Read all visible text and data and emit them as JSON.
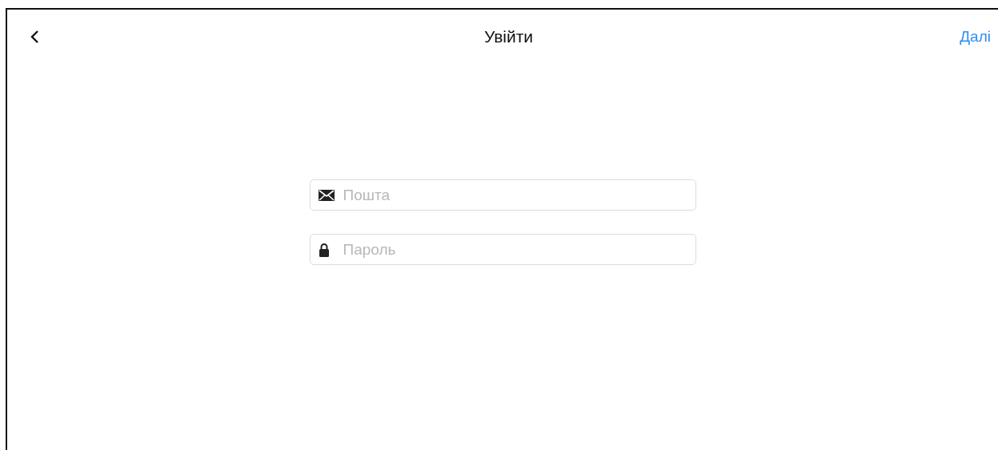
{
  "header": {
    "title": "Увійти",
    "next": "Далі"
  },
  "fields": [
    {
      "kind": "email",
      "placeholder": "Пошта"
    },
    {
      "kind": "password",
      "placeholder": "Пароль"
    }
  ]
}
